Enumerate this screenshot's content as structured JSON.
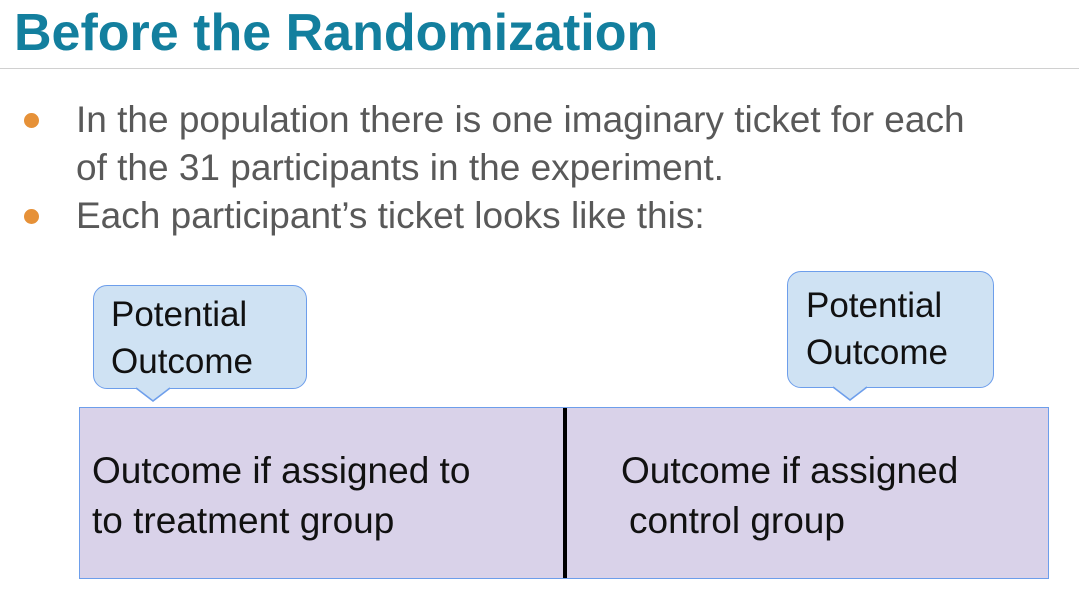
{
  "slide": {
    "title": "Before the Randomization",
    "bullets": [
      {
        "lines": [
          "In the population there is one imaginary ticket for each",
          "of the 31 participants in the experiment."
        ]
      },
      {
        "lines": [
          "Each participant’s ticket looks like this:"
        ]
      }
    ]
  },
  "callouts": {
    "left": [
      "Potential",
      "Outcome"
    ],
    "right": [
      "Potential",
      "Outcome"
    ]
  },
  "ticket": {
    "left": [
      "Outcome if assigned to",
      "to treatment group"
    ],
    "right": [
      "Outcome if assigned",
      "control group"
    ]
  },
  "colors": {
    "title": "#137f9e",
    "bullet_dot": "#e69138",
    "callout_fill": "#cfe2f3",
    "callout_border": "#6d9eeb",
    "ticket_fill": "#d9d2e9",
    "body_text": "#595959"
  }
}
